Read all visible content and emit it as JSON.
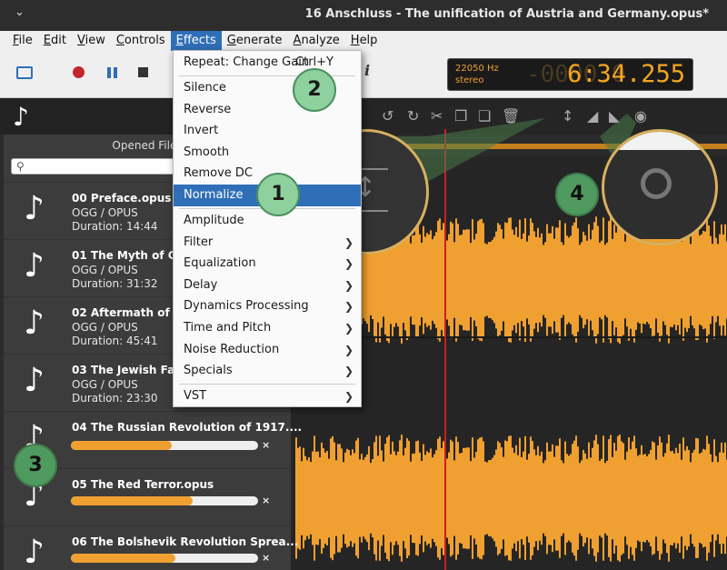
{
  "window": {
    "title": "16 Anschluss - The unification of Austria and Germany.opus*"
  },
  "menubar": {
    "items": [
      {
        "label": "File",
        "key": "F"
      },
      {
        "label": "Edit",
        "key": "E"
      },
      {
        "label": "View",
        "key": "V"
      },
      {
        "label": "Controls",
        "key": "C"
      },
      {
        "label": "Effects",
        "key": "E"
      },
      {
        "label": "Generate",
        "key": "G"
      },
      {
        "label": "Analyze",
        "key": "A"
      },
      {
        "label": "Help",
        "key": "H"
      }
    ]
  },
  "display": {
    "sample_rate": "22050 Hz",
    "channels": "stereo",
    "time": "6:34.255",
    "time_ghost": "-0000.0"
  },
  "effects_menu": {
    "repeat_label": "Repeat: Change Gain",
    "repeat_shortcut": "Ctrl+Y",
    "items": [
      "Silence",
      "Reverse",
      "Invert",
      "Smooth",
      "Remove DC",
      "Normalize",
      "Amplitude",
      "Filter",
      "Equalization",
      "Delay",
      "Dynamics Processing",
      "Time and Pitch",
      "Noise Reduction",
      "Specials",
      "VST"
    ],
    "selected": "Normalize"
  },
  "sidebar": {
    "header": "Opened Files",
    "files": [
      {
        "name": "00 Preface.opus",
        "type": "OGG / OPUS",
        "duration": "Duration: 14:44"
      },
      {
        "name": "01 The Myth of Germ",
        "type": "OGG / OPUS",
        "duration": "Duration: 31:32"
      },
      {
        "name": "02 Aftermath of the",
        "type": "OGG / OPUS",
        "duration": "Duration: 45:41"
      },
      {
        "name": "03 The Jewish Facto",
        "type": "OGG / OPUS",
        "duration": "Duration: 23:30"
      }
    ],
    "loading": [
      {
        "name": "04 The Russian Revolution of 1917....",
        "progress": 0.54
      },
      {
        "name": "05 The Red Terror.opus",
        "progress": 0.65
      },
      {
        "name": "06 The Bolshevik Revolution Sprea...",
        "progress": 0.56
      }
    ],
    "close_glyph": "×"
  },
  "callouts": [
    "1",
    "2",
    "3",
    "4"
  ],
  "colors": {
    "accent": "#2f6fb7",
    "wave": "#f0a030",
    "playhead": "#c62020",
    "badge": "#8fd19e"
  },
  "icons": [
    "music-note-icon",
    "search-icon",
    "record-icon",
    "pause-icon",
    "stop-icon",
    "undo-icon",
    "redo-icon",
    "cut-icon",
    "copy-icon",
    "paste-icon",
    "delete-icon",
    "normalize-icon",
    "volume-knob-icon"
  ]
}
